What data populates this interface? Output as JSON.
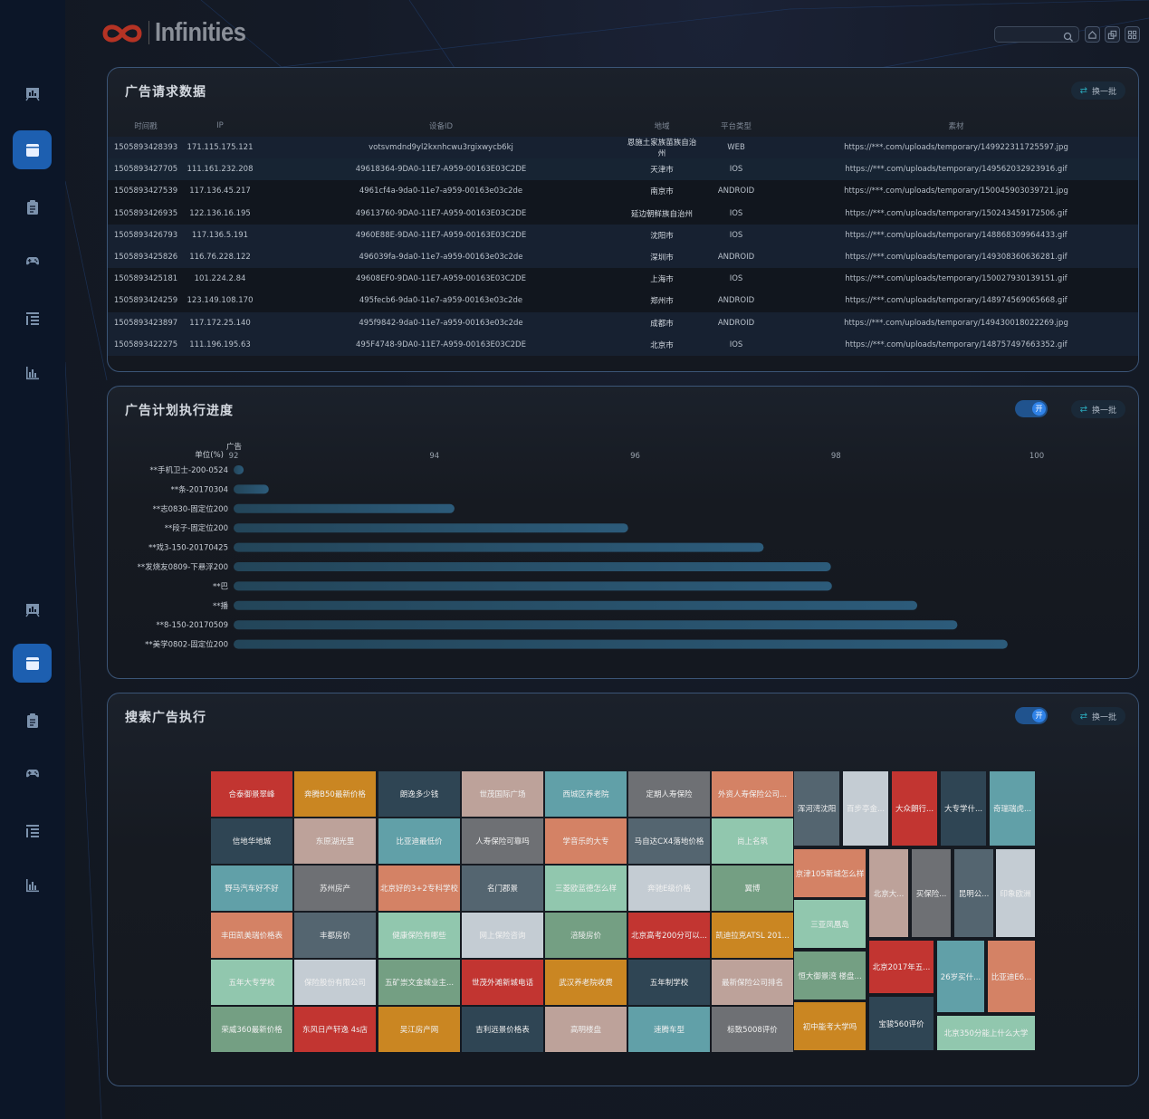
{
  "brand": {
    "name": "Infinities",
    "small": "INFINITIES"
  },
  "header": {
    "search_placeholder": "",
    "icons": [
      "search-icon",
      "home-icon",
      "copy-icon",
      "grid-icon"
    ]
  },
  "sidebar": {
    "items": [
      {
        "icon": "dashboard-icon",
        "active": false
      },
      {
        "icon": "window-icon",
        "active": true
      },
      {
        "icon": "clipboard-icon",
        "active": false
      },
      {
        "icon": "gamepad-icon",
        "active": false
      },
      {
        "icon": "list-icon",
        "active": false
      },
      {
        "icon": "bar-chart-icon",
        "active": false
      },
      {
        "icon": "dashboard-icon",
        "active": false
      },
      {
        "icon": "window-icon",
        "active": true
      },
      {
        "icon": "clipboard-icon",
        "active": false
      },
      {
        "icon": "gamepad-icon",
        "active": false
      },
      {
        "icon": "list-icon",
        "active": false
      },
      {
        "icon": "bar-chart-icon",
        "active": false
      }
    ]
  },
  "panel1": {
    "title": "广告请求数据",
    "swap": "换一批",
    "columns": [
      "时间戳",
      "IP",
      "设备ID",
      "地域",
      "平台类型",
      "素材"
    ],
    "rows": [
      [
        "1505893428393",
        "171.115.175.121",
        "votsvmdnd9yl2kxnhcwu3rgixwycb6kj",
        "恩施土家族苗族自治州",
        "WEB",
        "https://***.com/uploads/temporary/149922311725597.jpg"
      ],
      [
        "1505893427705",
        "111.161.232.208",
        "49618364-9DA0-11E7-A959-00163E03C2DE",
        "天津市",
        "IOS",
        "https://***.com/uploads/temporary/149562032923916.gif"
      ],
      [
        "1505893427539",
        "117.136.45.217",
        "4961cf4a-9da0-11e7-a959-00163e03c2de",
        "南京市",
        "ANDROID",
        "https://***.com/uploads/temporary/150045903039721.jpg"
      ],
      [
        "1505893426935",
        "122.136.16.195",
        "49613760-9DA0-11E7-A959-00163E03C2DE",
        "延边朝鲜族自治州",
        "IOS",
        "https://***.com/uploads/temporary/150243459172506.gif"
      ],
      [
        "1505893426793",
        "117.136.5.191",
        "4960E88E-9DA0-11E7-A959-00163E03C2DE",
        "沈阳市",
        "IOS",
        "https://***.com/uploads/temporary/148868309964433.gif"
      ],
      [
        "1505893425826",
        "116.76.228.122",
        "496039fa-9da0-11e7-a959-00163e03c2de",
        "深圳市",
        "ANDROID",
        "https://***.com/uploads/temporary/149308360636281.gif"
      ],
      [
        "1505893425181",
        "101.224.2.84",
        "49608EF0-9DA0-11E7-A959-00163E03C2DE",
        "上海市",
        "IOS",
        "https://***.com/uploads/temporary/150027930139151.gif"
      ],
      [
        "1505893424259",
        "123.149.108.170",
        "495fecb6-9da0-11e7-a959-00163e03c2de",
        "郑州市",
        "ANDROID",
        "https://***.com/uploads/temporary/148974569065668.gif"
      ],
      [
        "1505893423897",
        "117.172.25.140",
        "495f9842-9da0-11e7-a959-00163e03c2de",
        "成都市",
        "ANDROID",
        "https://***.com/uploads/temporary/149430018022269.jpg"
      ],
      [
        "1505893422275",
        "111.196.195.63",
        "495F4748-9DA0-11E7-A959-00163E03C2DE",
        "北京市",
        "IOS",
        "https://***.com/uploads/temporary/148757497663352.gif"
      ]
    ]
  },
  "panel2": {
    "title": "广告计划执行进度",
    "toggle": "开",
    "swap": "换一批"
  },
  "chart_data": {
    "type": "bar",
    "orientation": "horizontal",
    "title": "",
    "xlabel": "单位(%)",
    "series_name": "广告",
    "xlim": [
      92,
      100
    ],
    "ticks": [
      "92",
      "94",
      "96",
      "98",
      "100"
    ],
    "categories": [
      "**手机卫士-200-0524",
      "**条-20170304",
      "**志0830-固定位200",
      "**段子-固定位200",
      "**戏3-150-20170425",
      "**发烧友0809-下悬浮200",
      "**巴",
      "**播",
      "**8-150-20170509",
      "**美学0802-固定位200"
    ],
    "values": [
      92.1,
      92.35,
      94.2,
      95.93,
      97.28,
      97.95,
      97.96,
      98.81,
      99.21,
      99.71
    ],
    "bar_color": "#2a5676",
    "grid": false
  },
  "panel3": {
    "title": "搜索广告执行",
    "toggle": "开",
    "swap": "换一批",
    "palette": {
      "red": "#c23531",
      "orange": "#ca8622",
      "dark": "#2f4554",
      "pink": "#bda29a",
      "teal": "#61a0a8",
      "salmon": "#d48265",
      "mint": "#91c7ae",
      "green": "#749f83",
      "gray": "#6e7074",
      "slate": "#546570",
      "light": "#c4ccd3"
    },
    "tiles": [
      {
        "label": "合泰御景翠峰",
        "color": "#c23531"
      },
      {
        "label": "奔腾B50最新价格",
        "color": "#ca8622"
      },
      {
        "label": "朗逸多少钱",
        "color": "#2f4554"
      },
      {
        "label": "世茂国际广场",
        "color": "#bda29a"
      },
      {
        "label": "西城区养老院",
        "color": "#61a0a8"
      },
      {
        "label": "定期人寿保险",
        "color": "#6e7074"
      },
      {
        "label": "外资人寿保险公司...",
        "color": "#d48265"
      },
      {
        "label": "信地华地城",
        "color": "#2f4554"
      },
      {
        "label": "东原湖光里",
        "color": "#bda29a"
      },
      {
        "label": "比亚迪最低价",
        "color": "#61a0a8"
      },
      {
        "label": "人寿保险可靠吗",
        "color": "#6e7074"
      },
      {
        "label": "学音乐的大专",
        "color": "#d48265"
      },
      {
        "label": "马自达CX4落地价格",
        "color": "#546570"
      },
      {
        "label": "尚上名筑",
        "color": "#91c7ae"
      },
      {
        "label": "野马汽车好不好",
        "color": "#61a0a8"
      },
      {
        "label": "苏州房产",
        "color": "#6e7074"
      },
      {
        "label": "北京好的3+2专科学校",
        "color": "#d48265"
      },
      {
        "label": "名门郡景",
        "color": "#546570"
      },
      {
        "label": "三菱欧蓝德怎么样",
        "color": "#91c7ae"
      },
      {
        "label": "奔驰E级价格",
        "color": "#c4ccd3"
      },
      {
        "label": "翼博",
        "color": "#749f83"
      },
      {
        "label": "丰田凯美瑞价格表",
        "color": "#d48265"
      },
      {
        "label": "丰都房价",
        "color": "#546570"
      },
      {
        "label": "健康保险有哪些",
        "color": "#91c7ae"
      },
      {
        "label": "网上保险咨询",
        "color": "#c4ccd3"
      },
      {
        "label": "涪陵房价",
        "color": "#749f83"
      },
      {
        "label": "北京高考200分可以...",
        "color": "#c23531"
      },
      {
        "label": "凯迪拉克ATSL 201...",
        "color": "#ca8622"
      },
      {
        "label": "五年大专学校",
        "color": "#91c7ae"
      },
      {
        "label": "保险股份有限公司",
        "color": "#c4ccd3"
      },
      {
        "label": "五矿崇文金城业主...",
        "color": "#749f83"
      },
      {
        "label": "世茂外滩新城电话",
        "color": "#c23531"
      },
      {
        "label": "武汉养老院收费",
        "color": "#ca8622"
      },
      {
        "label": "五年制学校",
        "color": "#2f4554"
      },
      {
        "label": "最新保险公司排名",
        "color": "#bda29a"
      },
      {
        "label": "荣威360最新价格",
        "color": "#749f83"
      },
      {
        "label": "东风日产轩逸 4s店",
        "color": "#c23531"
      },
      {
        "label": "吴江房产网",
        "color": "#ca8622"
      },
      {
        "label": "吉利远景价格表",
        "color": "#2f4554"
      },
      {
        "label": "高明楼盘",
        "color": "#bda29a"
      },
      {
        "label": "速腾车型",
        "color": "#61a0a8"
      },
      {
        "label": "标致5008评价",
        "color": "#6e7074"
      },
      {
        "label": "浑河湾沈阳",
        "color": "#546570"
      },
      {
        "label": "百步亭金...",
        "color": "#c4ccd3"
      },
      {
        "label": "大众朗行...",
        "color": "#c23531"
      },
      {
        "label": "大专学什...",
        "color": "#2f4554"
      },
      {
        "label": "奇瑞瑞虎...",
        "color": "#61a0a8"
      },
      {
        "label": "京津105新城怎么样",
        "color": "#d48265"
      },
      {
        "label": "三亚凤凰岛",
        "color": "#91c7ae"
      },
      {
        "label": "恒大御景湾 楼盘...",
        "color": "#749f83"
      },
      {
        "label": "初中能考大学吗",
        "color": "#ca8622"
      },
      {
        "label": "北京大...",
        "color": "#bda29a"
      },
      {
        "label": "买保险...",
        "color": "#6e7074"
      },
      {
        "label": "昆明公...",
        "color": "#546570"
      },
      {
        "label": "印象欧洲",
        "color": "#c4ccd3"
      },
      {
        "label": "北京2017年五...",
        "color": "#c23531"
      },
      {
        "label": "宝骏560评价",
        "color": "#2f4554"
      },
      {
        "label": "26岁买什...",
        "color": "#61a0a8"
      },
      {
        "label": "比亚迪E6...",
        "color": "#d48265"
      },
      {
        "label": "北京350分能上什么大学",
        "color": "#91c7ae"
      }
    ]
  }
}
